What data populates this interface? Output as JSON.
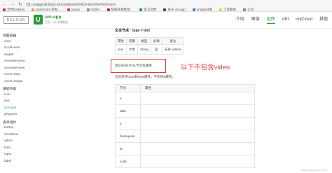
{
  "browser": {
    "url": "uniapp.dcloud.io/component/rich-text?id=rich-text",
    "bookmarks": [
      {
        "label": "文档Nalkalia",
        "color": "#d33"
      },
      {
        "label": "JavaScript 开发...",
        "color": "#f5a623"
      },
      {
        "label": "jquery",
        "color": "#e33"
      },
      {
        "label": "fiddler",
        "color": "#888"
      },
      {
        "label": "快速开发框架...",
        "color": "#d22"
      },
      {
        "label": "官方文档",
        "color": "#2b9939"
      },
      {
        "label": "关于 uni-app",
        "color": "#444"
      },
      {
        "label": "uniapp开发",
        "color": "#3a7bd5"
      },
      {
        "label": "工作相关",
        "color": "#f5c542"
      },
      {
        "label": "公司",
        "color": "#888"
      }
    ]
  },
  "header": {
    "logo_text": "DCLOUD",
    "badge": "U",
    "title": "uni-app",
    "subtitle": "开发一次 多端覆盖",
    "nav": [
      "介绍",
      "框架",
      "组件",
      "API",
      "uniCloud",
      "其他"
    ],
    "active_nav": "组件"
  },
  "sidebar": {
    "items": [
      {
        "label": "视图容器",
        "group": true
      },
      {
        "label": "view"
      },
      {
        "label": "scroll-view"
      },
      {
        "label": "swiper"
      },
      {
        "label": "movable-area"
      },
      {
        "label": "movable-view"
      },
      {
        "label": "cover-view"
      },
      {
        "label": "cover-image"
      },
      {
        "label": "基础内容",
        "group": true
      },
      {
        "label": "icon"
      },
      {
        "label": "text"
      },
      {
        "label": "rich-text",
        "active": true
      },
      {
        "label": "progress"
      },
      {
        "label": "表单组件",
        "group": true
      },
      {
        "label": "button"
      },
      {
        "label": "checkbox"
      },
      {
        "label": "editor"
      },
      {
        "label": "form"
      },
      {
        "label": "input"
      },
      {
        "label": "label"
      }
    ]
  },
  "content": {
    "text_node_heading": "文本节点：type = text",
    "props_table": {
      "headers": [
        "属性",
        "说明",
        "类型",
        "必填",
        "备注"
      ],
      "rows": [
        [
          "text",
          "文本",
          "String",
          "是",
          "支持 entities"
        ]
      ]
    },
    "callout_text": "受信任的HTML节点及属性",
    "red_note": "以下不包含video",
    "desc": "全局支持class和style属性，不支持id属性。",
    "tags_table": {
      "headers": [
        "节点",
        "属性"
      ],
      "rows": [
        "a",
        "abbr",
        "b",
        "blockquote",
        "br",
        "code"
      ]
    }
  },
  "watermark": "https://blog.csdn.net/..."
}
